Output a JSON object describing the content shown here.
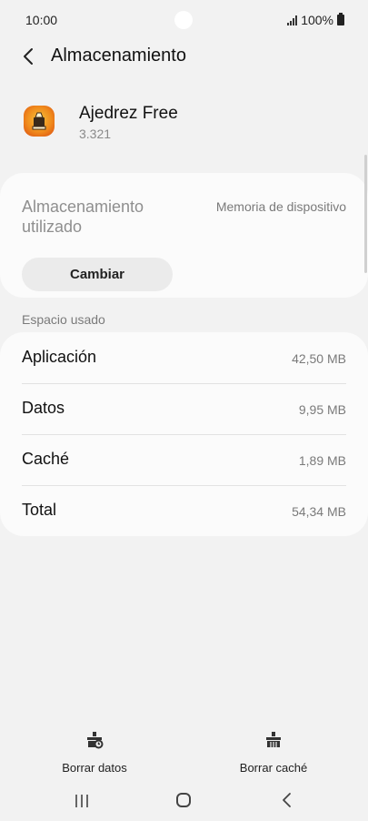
{
  "status_bar": {
    "time": "10:00",
    "battery": "100%"
  },
  "header": {
    "title": "Almacenamiento"
  },
  "app": {
    "name": "Ajedrez Free",
    "version": "3.321",
    "icon": "chess-app-icon"
  },
  "storage": {
    "label": "Almacenamiento utilizado",
    "value": "Memoria de dispositivo",
    "change_label": "Cambiar"
  },
  "usage": {
    "section_label": "Espacio usado",
    "rows": [
      {
        "label": "Aplicación",
        "value": "42,50 MB"
      },
      {
        "label": "Datos",
        "value": "9,95 MB"
      },
      {
        "label": "Caché",
        "value": "1,89 MB"
      },
      {
        "label": "Total",
        "value": "54,34 MB"
      }
    ]
  },
  "actions": {
    "clear_data": "Borrar datos",
    "clear_cache": "Borrar caché"
  },
  "colors": {
    "background": "#f2f2f2",
    "card": "#fbfbfb",
    "secondary_text": "#7a7a7a"
  }
}
